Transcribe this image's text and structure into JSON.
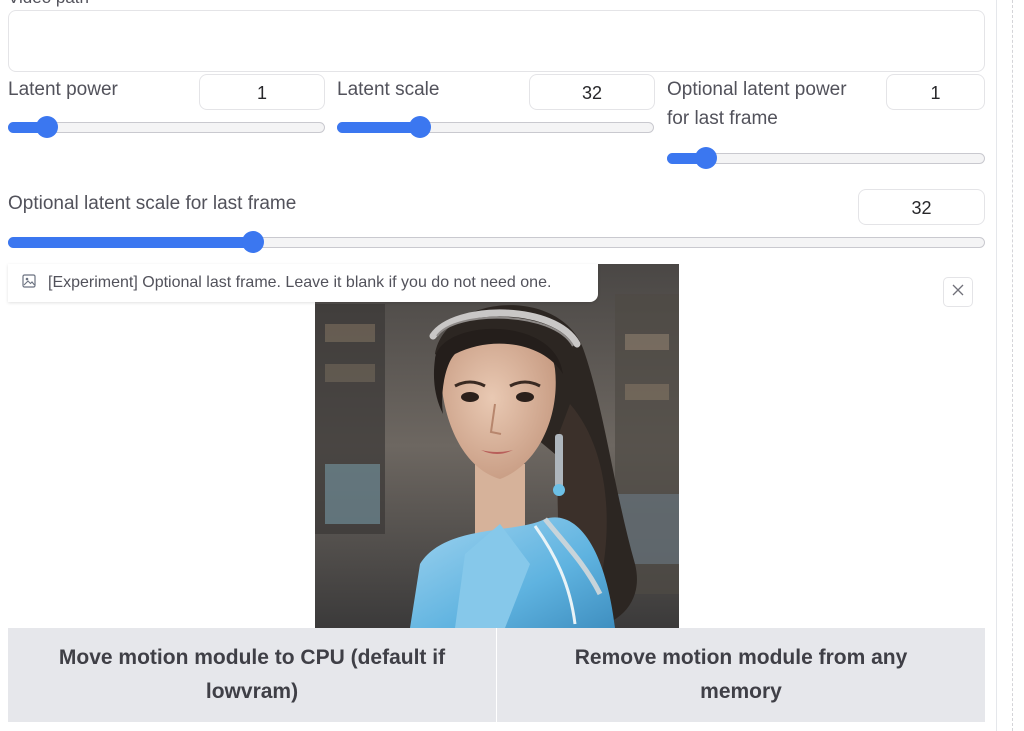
{
  "video": {
    "label": "Video path",
    "value": ""
  },
  "latent_power": {
    "label": "Latent power",
    "value": "1",
    "fraction": 0.12
  },
  "latent_scale": {
    "label": "Latent scale",
    "value": "32",
    "fraction": 0.26
  },
  "opt_latent_power": {
    "label_line1": "Optional latent power",
    "label_line2": "for last frame",
    "value": "1",
    "fraction": 0.12
  },
  "opt_latent_scale": {
    "label": "Optional latent scale for last frame",
    "value": "32",
    "fraction": 0.25
  },
  "last_frame": {
    "label": "[Experiment] Optional last frame. Leave it blank if you do not need one.",
    "close_symbol": "×"
  },
  "buttons": {
    "move_line1": "Move motion module to CPU (default if",
    "move_line2": "lowvram)",
    "remove_line1": "Remove motion module from any",
    "remove_line2": "memory"
  },
  "colors": {
    "accent": "#3b77f0",
    "button_bg": "#e6e7eb"
  }
}
